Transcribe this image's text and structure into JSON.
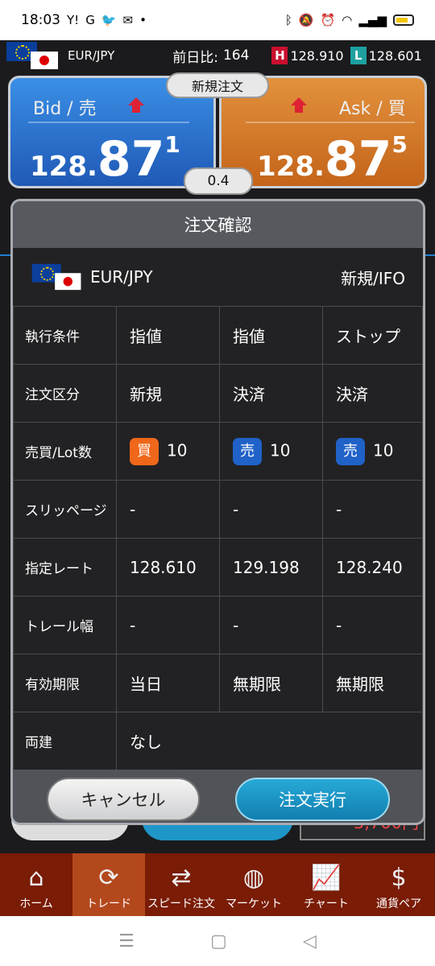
{
  "status_bar": {
    "time": "18:03",
    "left_icons": [
      "Y!",
      "G",
      "twitter-icon",
      "mail-icon",
      "•"
    ]
  },
  "pair_header": {
    "pair": "EUR/JPY",
    "change_label": "前日比:",
    "change_value": "164",
    "high_badge": "H",
    "high_value": "128.910",
    "low_badge": "L",
    "low_value": "128.601"
  },
  "bid": {
    "label": "Bid",
    "sub": "売",
    "price_a": "128.",
    "price_b": "87",
    "price_c": "1"
  },
  "ask": {
    "label": "Ask",
    "sub": "買",
    "price_a": "128.",
    "price_b": "87",
    "price_c": "5"
  },
  "new_order_badge": "新規注文",
  "spread": "0.4",
  "background_loss": "-3,700円",
  "modal": {
    "title": "注文確認",
    "pair": "EUR/JPY",
    "order_type": "新規/IFO",
    "rows": [
      {
        "label": "執行条件",
        "values": [
          "指値",
          "指値",
          "ストップ"
        ]
      },
      {
        "label": "注文区分",
        "values": [
          "新規",
          "決済",
          "決済"
        ]
      },
      {
        "label": "売買/Lot数",
        "sides": [
          "買",
          "売",
          "売"
        ],
        "values": [
          "10",
          "10",
          "10"
        ]
      },
      {
        "label": "スリッページ",
        "values": [
          "-",
          "-",
          "-"
        ]
      },
      {
        "label": "指定レート",
        "values": [
          "128.610",
          "129.198",
          "128.240"
        ]
      },
      {
        "label": "トレール幅",
        "values": [
          "-",
          "-",
          "-"
        ]
      },
      {
        "label": "有効期限",
        "values": [
          "当日",
          "無期限",
          "無期限"
        ]
      },
      {
        "label": "両建",
        "values": [
          "なし"
        ]
      }
    ],
    "cancel_label": "キャンセル",
    "execute_label": "注文実行"
  },
  "nav": [
    {
      "label": "ホーム",
      "icon": "home-icon"
    },
    {
      "label": "トレード",
      "icon": "trade-icon",
      "active": true
    },
    {
      "label": "スピード注文",
      "icon": "speed-order-icon"
    },
    {
      "label": "マーケット",
      "icon": "globe-icon"
    },
    {
      "label": "チャート",
      "icon": "chart-icon"
    },
    {
      "label": "通貨ペア",
      "icon": "currency-pair-icon"
    }
  ],
  "colors": {
    "bid": "#1f59b6",
    "ask": "#c4641a",
    "buy_badge": "#f0671a",
    "sell_badge": "#2062c8",
    "nav_bg": "#7a1c06",
    "nav_active": "#b4481d",
    "execute": "#117fb0"
  }
}
